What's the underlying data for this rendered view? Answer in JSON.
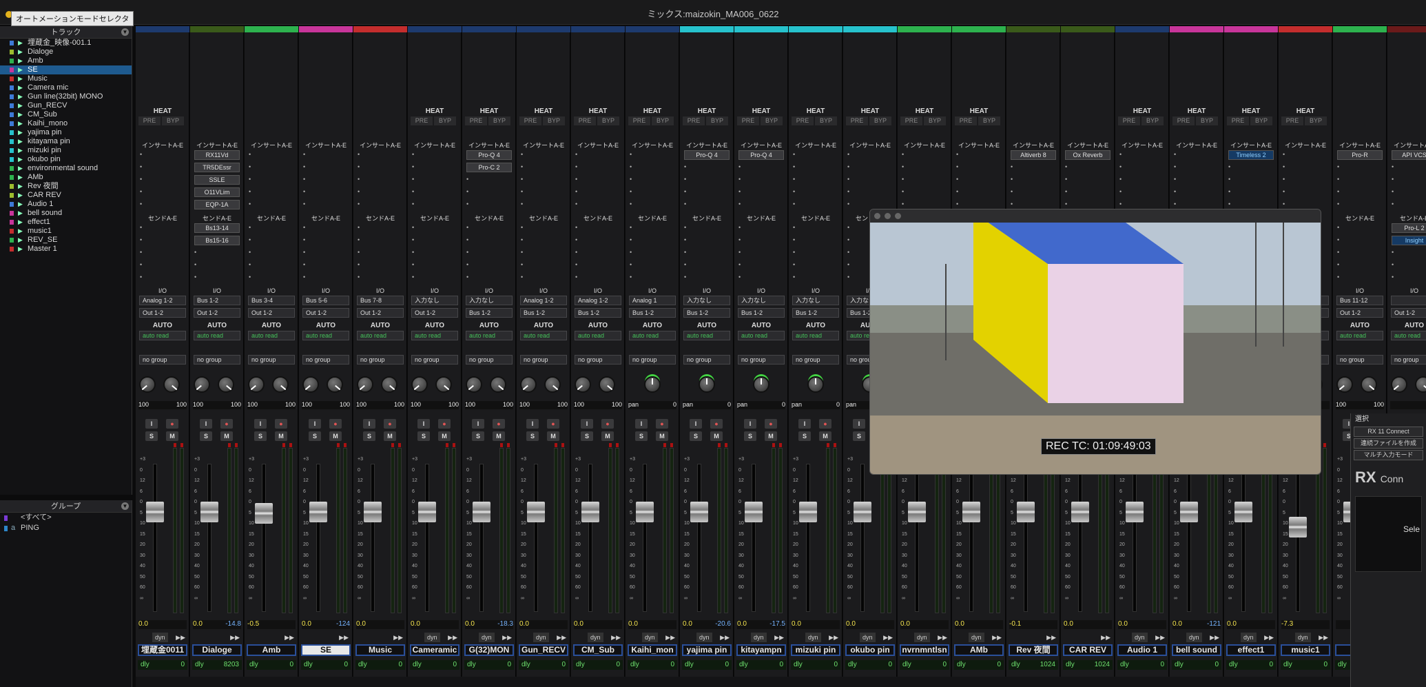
{
  "window": {
    "title": "ミックス:maizokin_MA006_0622"
  },
  "tooltip": "オートメーションモードセレクタ",
  "tracklist": {
    "header": "トラック",
    "tracks": [
      {
        "name": "埋蔵金_映像-001.1",
        "color": "#3e7ad6",
        "selected": false
      },
      {
        "name": "Dialoge",
        "color": "#9cbd2e",
        "selected": false
      },
      {
        "name": "Amb",
        "color": "#2db24e",
        "selected": false
      },
      {
        "name": "SE",
        "color": "#c8359a",
        "selected": true
      },
      {
        "name": "Music",
        "color": "#c42d2d",
        "selected": false
      },
      {
        "name": "Camera mic",
        "color": "#3e7ad6",
        "selected": false
      },
      {
        "name": "Gun line(32bit) MONO",
        "color": "#3e7ad6",
        "selected": false
      },
      {
        "name": "Gun_RECV",
        "color": "#3e7ad6",
        "selected": false
      },
      {
        "name": "CM_Sub",
        "color": "#3e7ad6",
        "selected": false
      },
      {
        "name": "Kaihi_mono",
        "color": "#3e7ad6",
        "selected": false
      },
      {
        "name": "yajima pin",
        "color": "#26c2cc",
        "selected": false
      },
      {
        "name": "kitayama pin",
        "color": "#26c2cc",
        "selected": false
      },
      {
        "name": "mizuki pin",
        "color": "#26c2cc",
        "selected": false
      },
      {
        "name": "okubo pin",
        "color": "#26c2cc",
        "selected": false
      },
      {
        "name": "environmental sound",
        "color": "#2db24e",
        "selected": false
      },
      {
        "name": "AMb",
        "color": "#2db24e",
        "selected": false
      },
      {
        "name": "Rev 夜間",
        "color": "#9cbd2e",
        "selected": false
      },
      {
        "name": "CAR REV",
        "color": "#9cbd2e",
        "selected": false
      },
      {
        "name": "Audio 1",
        "color": "#3e7ad6",
        "selected": false
      },
      {
        "name": "bell sound",
        "color": "#c8359a",
        "selected": false
      },
      {
        "name": "effect1",
        "color": "#c8359a",
        "selected": false
      },
      {
        "name": "music1",
        "color": "#c42d2d",
        "selected": false
      },
      {
        "name": "REV_SE",
        "color": "#2db24e",
        "selected": false
      },
      {
        "name": "Master 1",
        "color": "#c42d2d",
        "selected": false
      }
    ]
  },
  "groups": {
    "header": "グループ",
    "items": [
      {
        "name": "<すべて>",
        "color": "#7a3ad6",
        "letter": ""
      },
      {
        "name": "PING",
        "color": "#2d86c8",
        "letter": "a"
      }
    ]
  },
  "strip_labels": {
    "heat": "HEAT",
    "pre": "PRE",
    "byp": "BYP",
    "inserts": "インサートA-E",
    "sends": "センドA-E",
    "io": "I/O",
    "auto": "AUTO",
    "auto_mode": "auto read",
    "group": "no group",
    "solo": "S",
    "mute": "M",
    "input": "I",
    "dyn": "dyn",
    "dly": "dly"
  },
  "scale_ticks": [
    "+3",
    "0",
    "12",
    "6",
    "0",
    "5",
    "10",
    "15",
    "20",
    "30",
    "40",
    "50",
    "60",
    "∞"
  ],
  "strips": [
    {
      "name": "埋蔵金0011",
      "color": "#1d3a6e",
      "inserts": [],
      "sends": [],
      "input": "Analog 1-2",
      "output": "Out 1-2",
      "pan_l": "100",
      "pan_r": "100",
      "stereo": true,
      "vol": "0.0",
      "vol2": "",
      "dly": "0",
      "dynval": "",
      "heat": true,
      "dyn": true
    },
    {
      "name": "Dialoge",
      "color": "#3a5a1a",
      "inserts": [
        "RX11Vd",
        "TR5DEssr",
        "SSLE",
        "O11VLim",
        "EQP-1A"
      ],
      "sends": [
        "Bs13-14",
        "Bs15-16"
      ],
      "input": "Bus 1-2",
      "output": "Out 1-2",
      "pan_l": "100",
      "pan_r": "100",
      "stereo": true,
      "vol": "0.0",
      "vol2": "-14.8",
      "dly": "8203",
      "dynval": "",
      "heat": false,
      "dyn": false
    },
    {
      "name": "Amb",
      "color": "#2db24e",
      "inserts": [],
      "sends": [],
      "input": "Bus 3-4",
      "output": "Out 1-2",
      "pan_l": "100",
      "pan_r": "100",
      "stereo": true,
      "vol": "-0.5",
      "vol2": "",
      "dly": "0",
      "dynval": "",
      "heat": false,
      "dyn": false
    },
    {
      "name": "SE",
      "color": "#c8359a",
      "inserts": [],
      "sends": [],
      "input": "Bus 5-6",
      "output": "Out 1-2",
      "pan_l": "100",
      "pan_r": "100",
      "stereo": true,
      "vol": "0.0",
      "vol2": "-124",
      "dly": "0",
      "dynval": "",
      "heat": false,
      "dyn": false
    },
    {
      "name": "Music",
      "color": "#c42d2d",
      "inserts": [],
      "sends": [],
      "input": "Bus 7-8",
      "output": "Out 1-2",
      "pan_l": "100",
      "pan_r": "100",
      "stereo": true,
      "vol": "0.0",
      "vol2": "",
      "dly": "0",
      "dynval": "",
      "heat": false,
      "dyn": false
    },
    {
      "name": "Cameramic",
      "color": "#1d3a6e",
      "inserts": [],
      "sends": [],
      "input": "入力なし",
      "output": "Out 1-2",
      "pan_l": "100",
      "pan_r": "100",
      "stereo": true,
      "vol": "0.0",
      "vol2": "",
      "dly": "0",
      "dynval": "",
      "heat": true,
      "dyn": true
    },
    {
      "name": "G(32)MON",
      "color": "#1d3a6e",
      "inserts": [
        "Pro-Q 4",
        "Pro-C 2"
      ],
      "sends": [],
      "input": "入力なし",
      "output": "Bus 1-2",
      "pan_l": "100",
      "pan_r": "100",
      "stereo": true,
      "vol": "0.0",
      "vol2": "-18.3",
      "dly": "0",
      "dynval": "",
      "heat": true,
      "dyn": true
    },
    {
      "name": "Gun_RECV",
      "color": "#1d3a6e",
      "inserts": [],
      "sends": [],
      "input": "Analog 1-2",
      "output": "Bus 1-2",
      "pan_l": "100",
      "pan_r": "100",
      "stereo": true,
      "vol": "0.0",
      "vol2": "",
      "dly": "0",
      "dynval": "",
      "heat": true,
      "dyn": true
    },
    {
      "name": "CM_Sub",
      "color": "#1d3a6e",
      "inserts": [],
      "sends": [],
      "input": "Analog 1-2",
      "output": "Bus 1-2",
      "pan_l": "100",
      "pan_r": "100",
      "stereo": true,
      "vol": "0.0",
      "vol2": "",
      "dly": "0",
      "dynval": "",
      "heat": true,
      "dyn": true
    },
    {
      "name": "Kaihi_mon",
      "color": "#1d3a6e",
      "inserts": [],
      "sends": [],
      "input": "Analog 1",
      "output": "Bus 1-2",
      "pan_l": "pan",
      "pan_r": "0",
      "stereo": false,
      "vol": "0.0",
      "vol2": "",
      "dly": "0",
      "dynval": "",
      "heat": true,
      "dyn": true
    },
    {
      "name": "yajima pin",
      "color": "#26c2cc",
      "inserts": [
        "Pro-Q 4"
      ],
      "sends": [],
      "input": "入力なし",
      "output": "Bus 1-2",
      "pan_l": "pan",
      "pan_r": "0",
      "stereo": false,
      "vol": "0.0",
      "vol2": "-20.6",
      "dly": "0",
      "dynval": "",
      "heat": true,
      "dyn": true
    },
    {
      "name": "kitayampn",
      "color": "#26c2cc",
      "inserts": [
        "Pro-Q 4"
      ],
      "sends": [],
      "input": "入力なし",
      "output": "Bus 1-2",
      "pan_l": "pan",
      "pan_r": "0",
      "stereo": false,
      "vol": "0.0",
      "vol2": "-17.5",
      "dly": "0",
      "dynval": "",
      "heat": true,
      "dyn": true
    },
    {
      "name": "mizuki pin",
      "color": "#26c2cc",
      "inserts": [],
      "sends": [],
      "input": "入力なし",
      "output": "Bus 1-2",
      "pan_l": "pan",
      "pan_r": "0",
      "stereo": false,
      "vol": "0.0",
      "vol2": "",
      "dly": "0",
      "dynval": "",
      "heat": true,
      "dyn": true
    },
    {
      "name": "okubo pin",
      "color": "#26c2cc",
      "inserts": [],
      "sends": [],
      "input": "入力なし",
      "output": "Bus 1-2",
      "pan_l": "pan",
      "pan_r": "0",
      "stereo": false,
      "vol": "0.0",
      "vol2": "",
      "dly": "0",
      "dynval": "",
      "heat": true,
      "dyn": true
    },
    {
      "name": "nvrnmntlsn",
      "color": "#2db24e",
      "inserts": [],
      "sends": [],
      "input": "",
      "output": "",
      "pan_l": "",
      "pan_r": "",
      "stereo": true,
      "vol": "0.0",
      "vol2": "",
      "dly": "0",
      "dynval": "",
      "heat": true,
      "dyn": true
    },
    {
      "name": "AMb",
      "color": "#2db24e",
      "inserts": [],
      "sends": [],
      "input": "",
      "output": "",
      "pan_l": "",
      "pan_r": "",
      "stereo": true,
      "vol": "0.0",
      "vol2": "",
      "dly": "0",
      "dynval": "",
      "heat": true,
      "dyn": true
    },
    {
      "name": "Rev 夜間",
      "color": "#3a5a1a",
      "inserts": [
        "Altiverb 8"
      ],
      "sends": [],
      "input": "",
      "output": "",
      "pan_l": "",
      "pan_r": "",
      "stereo": true,
      "vol": "-0.1",
      "vol2": "",
      "dly": "1024",
      "dynval": "",
      "heat": false,
      "dyn": false
    },
    {
      "name": "CAR REV",
      "color": "#3a5a1a",
      "inserts": [
        "Ox Reverb"
      ],
      "sends": [],
      "input": "",
      "output": "",
      "pan_l": "",
      "pan_r": "",
      "stereo": true,
      "vol": "0.0",
      "vol2": "",
      "dly": "1024",
      "dynval": "",
      "heat": false,
      "dyn": false
    },
    {
      "name": "Audio 1",
      "color": "#1d3a6e",
      "inserts": [],
      "sends": [],
      "input": "",
      "output": "",
      "pan_l": "",
      "pan_r": "",
      "stereo": true,
      "vol": "0.0",
      "vol2": "",
      "dly": "0",
      "dynval": "",
      "heat": true,
      "dyn": true
    },
    {
      "name": "bell sound",
      "color": "#c8359a",
      "inserts": [],
      "sends": [],
      "input": "",
      "output": "",
      "pan_l": "",
      "pan_r": "",
      "stereo": true,
      "vol": "0.0",
      "vol2": "-121",
      "dly": "0",
      "dynval": "",
      "heat": true,
      "dyn": true
    },
    {
      "name": "effect1",
      "color": "#c8359a",
      "inserts": [
        "Timeless 2"
      ],
      "sends": [],
      "input": "",
      "output": "",
      "pan_l": "",
      "pan_r": "",
      "stereo": true,
      "vol": "0.0",
      "vol2": "",
      "dly": "0",
      "dynval": "",
      "heat": true,
      "dyn": true
    },
    {
      "name": "music1",
      "color": "#c42d2d",
      "inserts": [],
      "sends": [],
      "input": "",
      "output": "",
      "pan_l": "",
      "pan_r": "",
      "stereo": true,
      "vol": "-7.3",
      "vol2": "",
      "dly": "0",
      "dynval": "",
      "heat": true,
      "dyn": true
    },
    {
      "name": "RE",
      "color": "#2db24e",
      "inserts": [
        "Pro-R"
      ],
      "sends": [],
      "input": "Bus 11-12",
      "output": "Out 1-2",
      "pan_l": "100",
      "pan_r": "100",
      "stereo": true,
      "vol": "",
      "vol2": "",
      "dly": "",
      "dynval": "",
      "heat": false,
      "dyn": false
    },
    {
      "name": "",
      "color": "#6b1a1a",
      "inserts": [
        "API VCS"
      ],
      "sends": [
        "Pro-L 2",
        "Insight"
      ],
      "input": "",
      "output": "Out 1-2",
      "pan_l": "",
      "pan_r": "",
      "stereo": true,
      "vol": "",
      "vol2": "",
      "dly": "",
      "dynval": "",
      "heat": false,
      "dyn": false
    }
  ],
  "video": {
    "rec_tc": "REC TC: 01:09:49:03"
  },
  "rx": {
    "label_select": "選択",
    "btn_connect": "RX 11 Connect",
    "btn_create": "連続ファイルを作成",
    "btn_multi": "マルチ入力モード",
    "logo": "RX",
    "logo_suffix": "Conn",
    "inner_text": "Sele"
  },
  "colors": {
    "accent": "#1e5a8f",
    "auto_green": "#45c15a",
    "volume_yellow": "#f6e650"
  }
}
